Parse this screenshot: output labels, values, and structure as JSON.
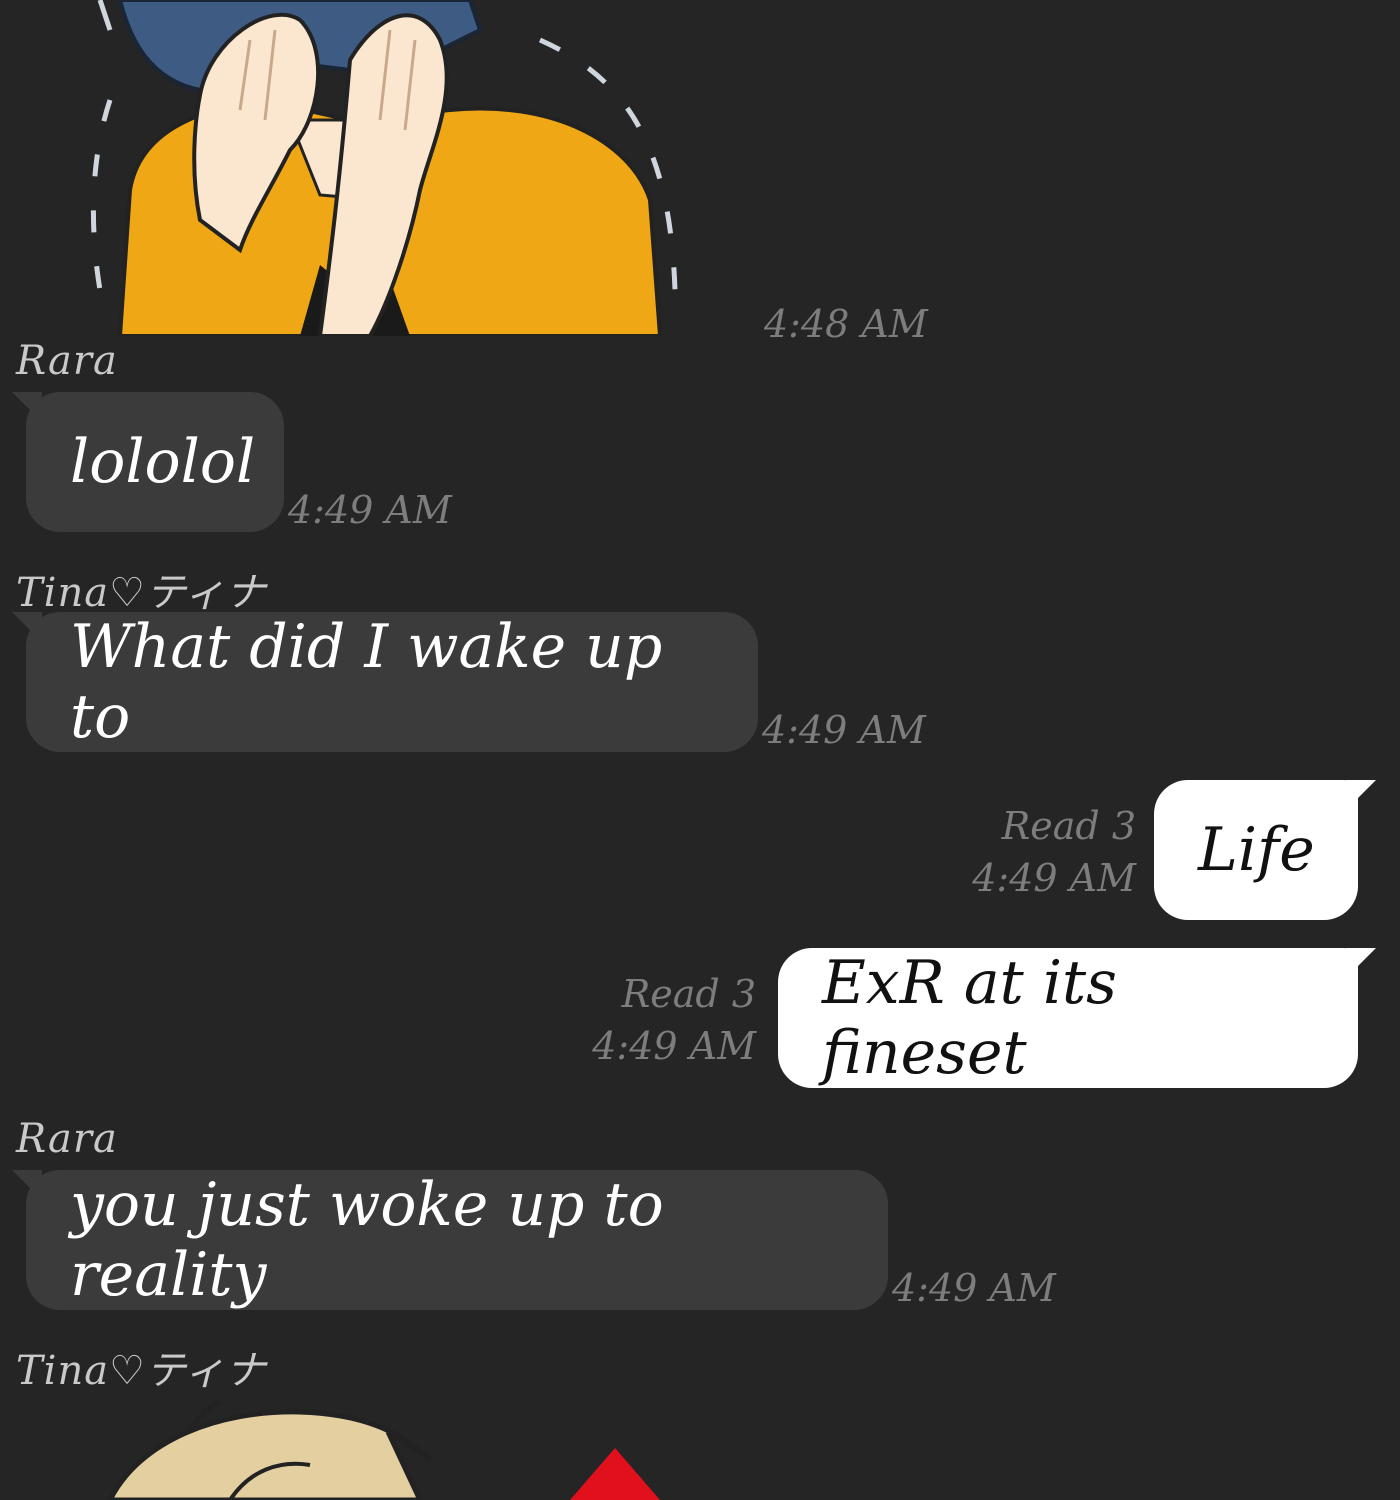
{
  "messages": [
    {
      "type": "sticker",
      "sender": "",
      "time": "4:48 AM",
      "sticker": "covering-face-sticker"
    },
    {
      "type": "text",
      "sender": "Rara",
      "text": "lololol",
      "time": "4:49 AM"
    },
    {
      "type": "text",
      "sender": "Tina♡ティナ",
      "text": "What did I wake up to",
      "time": "4:49 AM"
    },
    {
      "type": "outgoing",
      "read": "Read 3",
      "text": "Life",
      "time": "4:49 AM"
    },
    {
      "type": "outgoing",
      "read": "Read 3",
      "text": "ExR at its fineset",
      "time": "4:49 AM"
    },
    {
      "type": "text",
      "sender": "Rara",
      "text": "you just woke up to reality",
      "time": "4:49 AM"
    },
    {
      "type": "sticker",
      "sender": "Tina♡ティナ",
      "time": "",
      "sticker": "blond-character-sticker"
    }
  ],
  "colors": {
    "background": "#252525",
    "incoming_bubble": "#3b3b3b",
    "outgoing_bubble": "#ffffff",
    "timestamp": "#7d7d7d"
  }
}
